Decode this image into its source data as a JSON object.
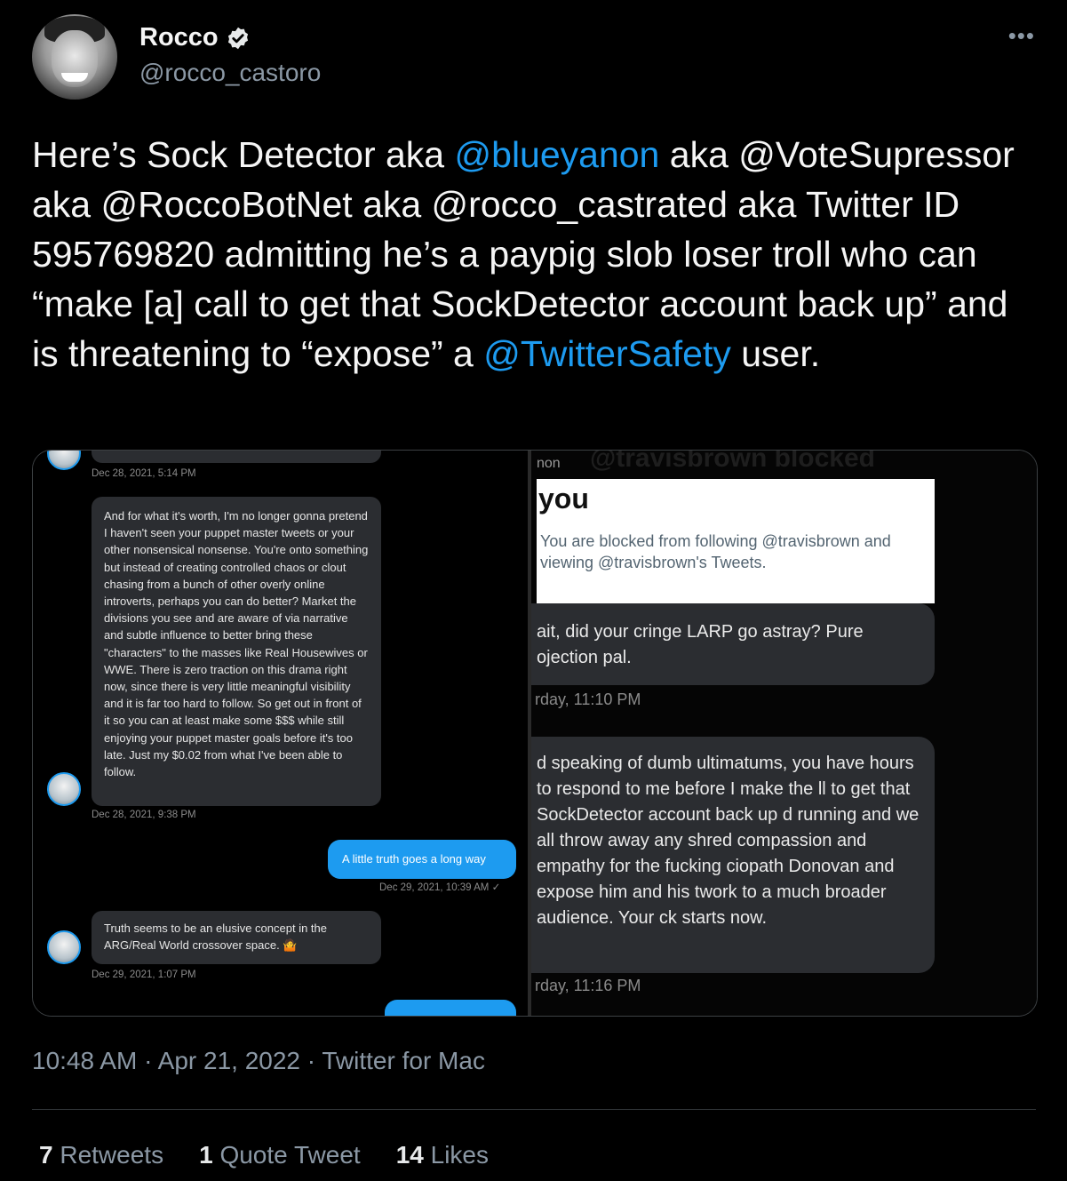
{
  "author": {
    "name": "Rocco",
    "handle": "@rocco_castoro"
  },
  "more_label": "•••",
  "tweet": {
    "part1": "Here’s Sock Detector aka ",
    "mention1": "@blueyanon",
    "part2": " aka @VoteSupressor aka @RoccoBotNet aka @rocco_castrated aka Twitter ID 595769820 admitting he’s a paypig slob loser troll who can “make [a] call to get that SockDetector account back up” and is threatening to “expose” a ",
    "mention2": "@TwitterSafety",
    "part3": " user."
  },
  "left_chat": {
    "ts1": "Dec 28, 2021, 5:14 PM",
    "msg_long": "And for what it's worth, I'm no longer gonna pretend I haven't seen your puppet master tweets or your other nonsensical nonsense. You're onto something but instead of creating controlled chaos or clout chasing from a bunch of other overly online introverts, perhaps you can do better? Market the divisions you see and are aware of via narrative and subtle influence to better bring these \"characters\" to the masses like Real Housewives or WWE. There is zero traction on this drama right now, since there is very little meaningful visibility and it is far too hard to follow. So get out in front of it so you can at least make some $$$ while still enjoying your puppet master goals before it's too late. Just my $0.02 from what I've been able to follow.",
    "ts2": "Dec 28, 2021, 9:38 PM",
    "blue_msg": "A little truth goes a long way",
    "ts3": "Dec 29, 2021, 10:39 AM ✓",
    "msg_short": "Truth seems to be an elusive concept in the ARG/Real World crossover space. 🤷",
    "ts4": "Dec 29, 2021, 1:07 PM"
  },
  "right_chat": {
    "top_label": "non",
    "faded_header": "@travisbrown blocked",
    "card_title": "you",
    "card_msg": "You are blocked from following @travisbrown and viewing @travisbrown's Tweets.",
    "bubble1": "ait, did your cringe LARP go astray? Pure ojection pal.",
    "ts1": "rday, 11:10 PM",
    "bubble2": "d speaking of dumb ultimatums, you have hours to respond to me before I make the ll to get that SockDetector account back up d running and we all throw away any shred compassion and empathy for the fucking ciopath Donovan and expose him and his twork to a much broader audience. Your ck starts now.",
    "ts2": "rday, 11:16 PM"
  },
  "meta": {
    "timestamp": "10:48 AM · Apr 21, 2022 · Twitter for Mac"
  },
  "stats": {
    "retweets_count": "7",
    "retweets_label": "Retweets",
    "quotes_count": "1",
    "quotes_label": "Quote Tweet",
    "likes_count": "14",
    "likes_label": "Likes"
  },
  "colors": {
    "background": "#000000",
    "link": "#1d9bf0",
    "muted": "#8b98a5"
  }
}
